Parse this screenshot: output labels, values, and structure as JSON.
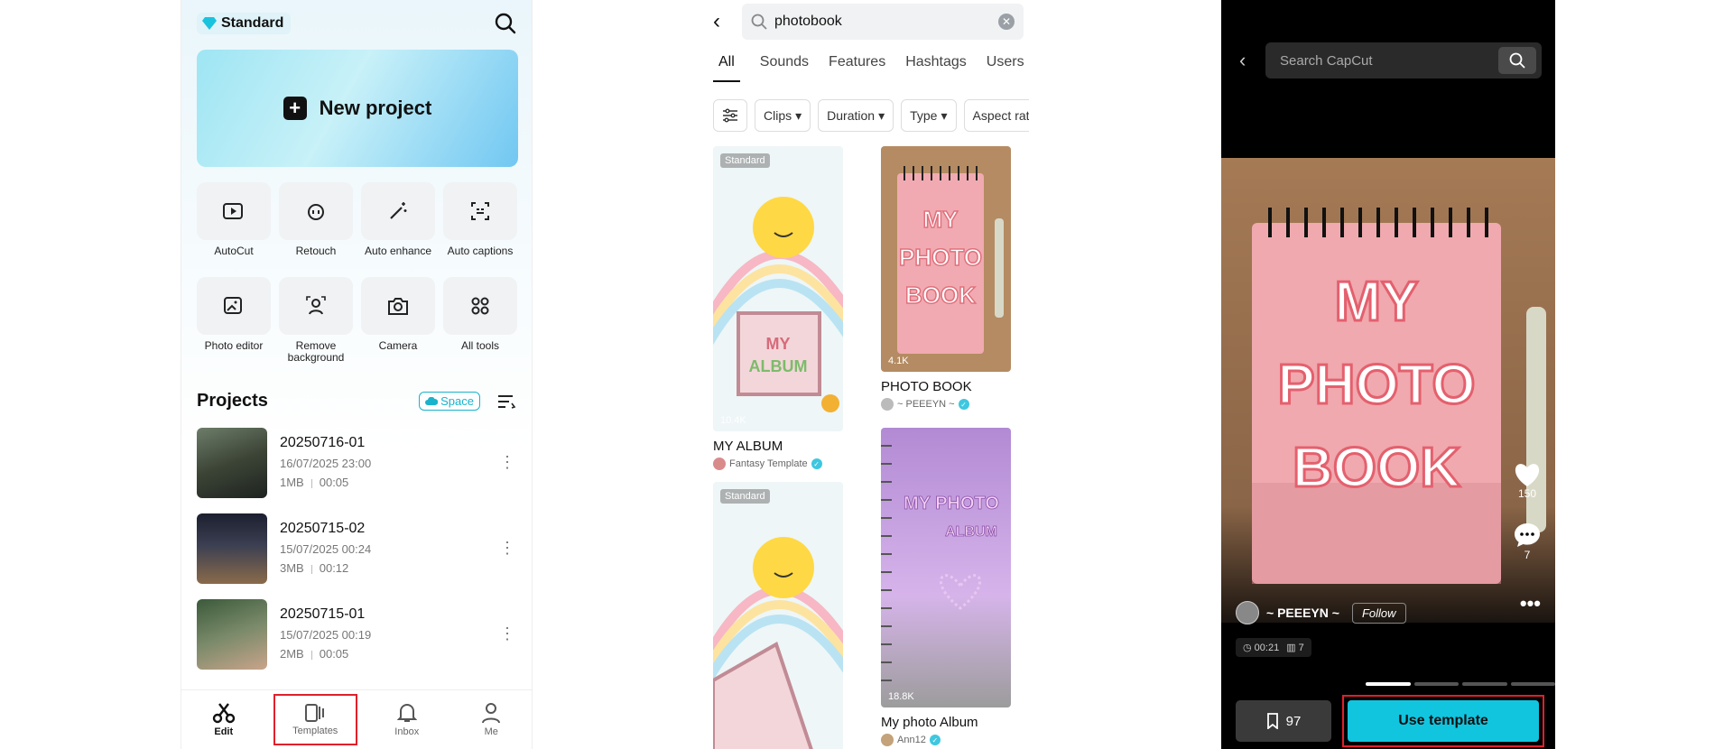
{
  "panel1": {
    "plan_label": "Standard",
    "new_project_label": "New project",
    "tools": [
      {
        "label": "AutoCut",
        "icon": "autocut-icon"
      },
      {
        "label": "Retouch",
        "icon": "retouch-icon"
      },
      {
        "label": "Auto enhance",
        "icon": "magic-wand-icon"
      },
      {
        "label": "Auto captions",
        "icon": "captions-icon"
      },
      {
        "label": "Photo editor",
        "icon": "photo-edit-icon"
      },
      {
        "label": "Remove background",
        "icon": "person-cutout-icon"
      },
      {
        "label": "Camera",
        "icon": "camera-icon"
      },
      {
        "label": "All tools",
        "icon": "grid-icon"
      }
    ],
    "projects_title": "Projects",
    "space_label": "Space",
    "projects": [
      {
        "name": "20250716-01",
        "date": "16/07/2025 23:00",
        "size": "1MB",
        "duration": "00:05"
      },
      {
        "name": "20250715-02",
        "date": "15/07/2025 00:24",
        "size": "3MB",
        "duration": "00:12"
      },
      {
        "name": "20250715-01",
        "date": "15/07/2025 00:19",
        "size": "2MB",
        "duration": "00:05"
      }
    ],
    "nav": [
      {
        "label": "Edit",
        "icon": "scissors-icon"
      },
      {
        "label": "Templates",
        "icon": "templates-icon"
      },
      {
        "label": "Inbox",
        "icon": "bell-icon"
      },
      {
        "label": "Me",
        "icon": "person-icon"
      }
    ]
  },
  "panel2": {
    "query": "photobook",
    "tabs": [
      "All",
      "Sounds",
      "Features",
      "Hashtags",
      "Users"
    ],
    "active_tab": "All",
    "filters": [
      "Clips",
      "Duration",
      "Type",
      "Aspect ratio"
    ],
    "cards": [
      {
        "title": "MY ALBUM",
        "author": "Fantasy Template",
        "uses": "10.4K",
        "badge": "Standard"
      },
      {
        "title": "PHOTO BOOK",
        "author": "~ PEEEYN ~",
        "uses": "4.1K",
        "badge": ""
      },
      {
        "title": "",
        "author": "",
        "uses": "",
        "badge": "Standard"
      },
      {
        "title": "My photo Album",
        "author": "Ann12",
        "uses": "18.8K",
        "badge": ""
      }
    ]
  },
  "panel3": {
    "search_placeholder": "Search CapCut",
    "likes": "150",
    "comments": "7",
    "author": "~ PEEEYN ~",
    "follow_label": "Follow",
    "duration": "00:21",
    "clips": "7",
    "saves": "97",
    "use_template_label": "Use template"
  },
  "colors": {
    "accent": "#11c5df",
    "highlight_box": "#e0202a"
  }
}
